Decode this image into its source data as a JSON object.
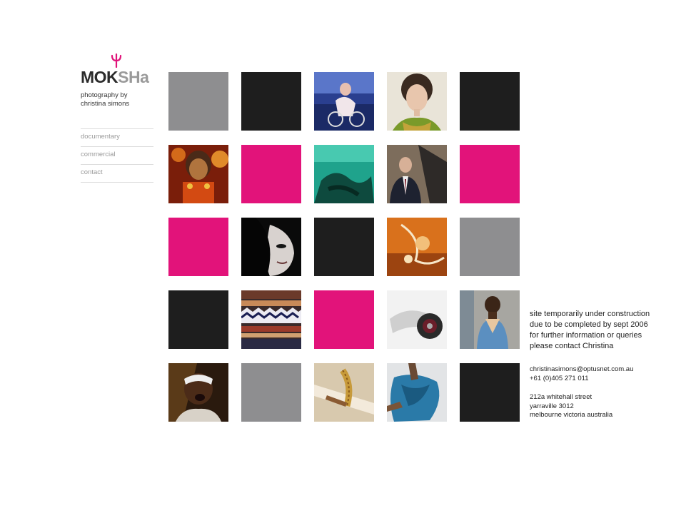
{
  "brand": {
    "logo_dark": "MOK",
    "logo_grey": "SHa",
    "accent_color": "#e0147a",
    "tagline_line1": "photography by",
    "tagline_line2": "christina simons"
  },
  "nav": {
    "items": [
      {
        "label": "documentary"
      },
      {
        "label": "commercial"
      },
      {
        "label": "contact"
      }
    ]
  },
  "grid": {
    "colors": {
      "grey": "#8e8e90",
      "black": "#1e1e1e",
      "pink": "#e2137a"
    },
    "rows": [
      [
        "grey",
        "black",
        "photo-cyclist",
        "photo-woman-portrait",
        "black"
      ],
      [
        "photo-holy-man",
        "pink",
        "photo-aerial-water",
        "photo-businessman",
        "pink"
      ],
      [
        "pink",
        "photo-dark-face",
        "black",
        "photo-orange-abstract",
        "grey"
      ],
      [
        "black",
        "photo-textile",
        "pink",
        "photo-wheel",
        "photo-child"
      ],
      [
        "photo-singer",
        "grey",
        "photo-craft-tools",
        "photo-fabric-hands",
        "black"
      ]
    ]
  },
  "notice": {
    "line1": "site temporarily under construction",
    "line2": "due to be completed by sept 2006",
    "line3": "for further information or queries",
    "line4": "please contact Christina"
  },
  "contact": {
    "email": "christinasimons@optusnet.com.au",
    "phone": "+61 (0)405 271 011",
    "address1": "212a whitehall street",
    "address2": "yarraville 3012",
    "address3": "melbourne victoria australia"
  }
}
